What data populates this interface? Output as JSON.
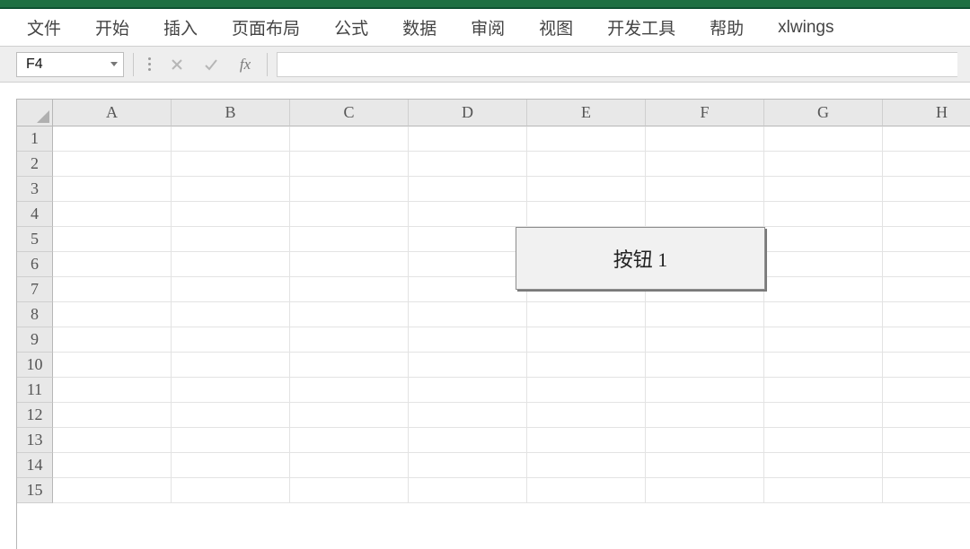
{
  "ribbon": {
    "tabs": [
      "文件",
      "开始",
      "插入",
      "页面布局",
      "公式",
      "数据",
      "审阅",
      "视图",
      "开发工具",
      "帮助",
      "xlwings"
    ]
  },
  "name_box": {
    "value": "F4"
  },
  "formula_bar": {
    "fx_label": "fx",
    "value": ""
  },
  "grid": {
    "columns": [
      "A",
      "B",
      "C",
      "D",
      "E",
      "F",
      "G",
      "H"
    ],
    "rows": [
      "1",
      "2",
      "3",
      "4",
      "5",
      "6",
      "7",
      "8",
      "9",
      "10",
      "11",
      "12",
      "13",
      "14",
      "15"
    ]
  },
  "form_button": {
    "label": "按钮 1"
  }
}
